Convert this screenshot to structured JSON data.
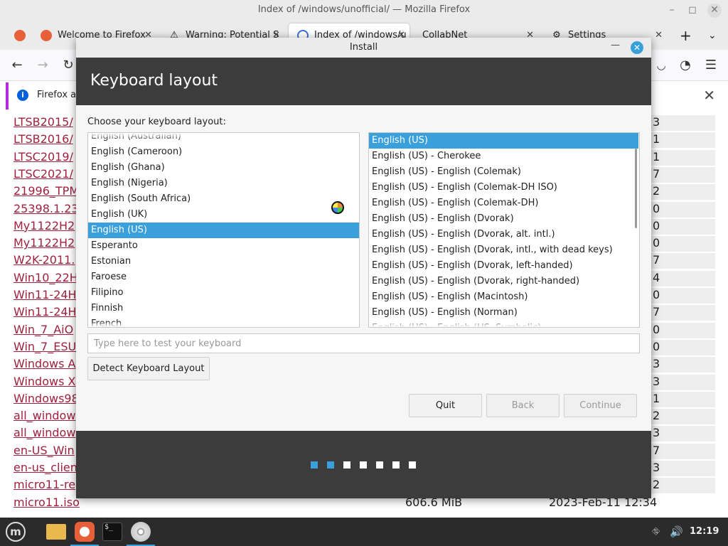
{
  "firefox": {
    "window_title": "Index of /windows/unofficial/ — Mozilla Firefox",
    "tabs": [
      {
        "label": "Welcome to Firefox",
        "close": "✕"
      },
      {
        "label": "Warning: Potential S",
        "close": "✕"
      },
      {
        "label": "Index of /windows/u",
        "close": "✕"
      },
      {
        "label": "CollabNet",
        "close": "✕"
      },
      {
        "label": "Settings",
        "close": "✕"
      }
    ],
    "new_tab": "+",
    "notification": {
      "text": "Firefox au",
      "close": "✕"
    },
    "rows": [
      {
        "name": "LTSB2015/",
        "size": "",
        "date": "",
        "tail": "3"
      },
      {
        "name": "LTSB2016/",
        "size": "",
        "date": "",
        "tail": "1"
      },
      {
        "name": "LTSC2019/",
        "size": "",
        "date": "",
        "tail": "1"
      },
      {
        "name": "LTSC2021/",
        "size": "",
        "date": "",
        "tail": "7"
      },
      {
        "name": "21996_TPM",
        "size": "",
        "date": "",
        "tail": "2"
      },
      {
        "name": "25398.1.23",
        "size": "",
        "date": "",
        "tail": "0"
      },
      {
        "name": "My1122H2",
        "size": "",
        "date": "",
        "tail": "0"
      },
      {
        "name": "My1122H2",
        "size": "",
        "date": "",
        "tail": "0"
      },
      {
        "name": "W2K-2011.",
        "size": "",
        "date": "",
        "tail": "7"
      },
      {
        "name": "Win10_22H",
        "size": "",
        "date": "",
        "tail": "4"
      },
      {
        "name": "Win11-24H",
        "size": "",
        "date": "",
        "tail": "0"
      },
      {
        "name": "Win11-24H",
        "size": "",
        "date": "",
        "tail": "7"
      },
      {
        "name": "Win_7_AiO",
        "size": "",
        "date": "",
        "tail": "0"
      },
      {
        "name": "Win_7_ESU",
        "size": "",
        "date": "",
        "tail": "0"
      },
      {
        "name": "Windows A",
        "size": "",
        "date": "",
        "tail": "3"
      },
      {
        "name": "Windows X",
        "size": "",
        "date": "",
        "tail": "3"
      },
      {
        "name": "Windows98",
        "size": "",
        "date": "",
        "tail": "1"
      },
      {
        "name": "all_window",
        "size": "",
        "date": "",
        "tail": "2"
      },
      {
        "name": "all_window",
        "size": "",
        "date": "",
        "tail": "3"
      },
      {
        "name": "en-US_Win",
        "size": "",
        "date": "",
        "tail": "7"
      },
      {
        "name": "en-us_clien",
        "size": "",
        "date": "",
        "tail": "3"
      },
      {
        "name": "micro11-re",
        "size": "",
        "date": "",
        "tail": "2"
      },
      {
        "name": "micro11.iso",
        "size": "606.6 MiB",
        "date": "2023-Feb-11 12:34",
        "tail": ""
      }
    ]
  },
  "install": {
    "window_title": "Install",
    "minimize": "—",
    "close": "✕",
    "heading": "Keyboard layout",
    "choose_label": "Choose your keyboard layout:",
    "languages": [
      "English (Australian)",
      "English (Cameroon)",
      "English (Ghana)",
      "English (Nigeria)",
      "English (South Africa)",
      "English (UK)",
      "English (US)",
      "Esperanto",
      "Estonian",
      "Faroese",
      "Filipino",
      "Finnish",
      "French"
    ],
    "selected_language_index": 6,
    "layouts": [
      "English (US)",
      "English (US) - Cherokee",
      "English (US) - English (Colemak)",
      "English (US) - English (Colemak-DH ISO)",
      "English (US) - English (Colemak-DH)",
      "English (US) - English (Dvorak)",
      "English (US) - English (Dvorak, alt. intl.)",
      "English (US) - English (Dvorak, intl., with dead keys)",
      "English (US) - English (Dvorak, left-handed)",
      "English (US) - English (Dvorak, right-handed)",
      "English (US) - English (Macintosh)",
      "English (US) - English (Norman)",
      "English (US) - English (US, Symbolic)"
    ],
    "selected_layout_index": 0,
    "test_placeholder": "Type here to test your keyboard",
    "detect_button": "Detect Keyboard Layout",
    "quit_button": "Quit",
    "back_button": "Back",
    "continue_button": "Continue",
    "progress": {
      "total_steps": 7,
      "completed_steps": 2
    },
    "colors": {
      "accent": "#3aa0dc",
      "header": "#3c3c3c"
    }
  },
  "taskbar": {
    "menu_glyph": "m",
    "terminal_glyph": "$_",
    "clock": "12:19",
    "icons": [
      "mint-menu-icon",
      "folder-icon",
      "firefox-icon",
      "terminal-icon",
      "disc-icon",
      "network-icon",
      "volume-icon"
    ]
  }
}
